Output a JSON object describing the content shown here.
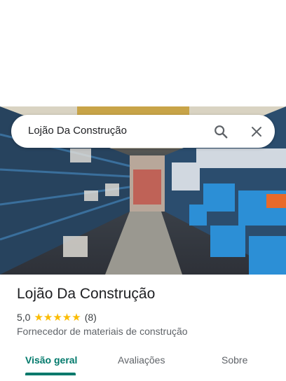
{
  "search": {
    "query": "Lojão Da Construção",
    "search_icon": "search-icon",
    "close_icon": "close-icon"
  },
  "place": {
    "name": "Lojão Da Construção",
    "rating": "5,0",
    "stars": "★★★★★",
    "review_count": "(8)",
    "category": "Fornecedor de materiais de construção"
  },
  "tabs": [
    {
      "label": "Visão geral",
      "active": true
    },
    {
      "label": "Avaliações",
      "active": false
    },
    {
      "label": "Sobre",
      "active": false
    }
  ],
  "colors": {
    "accent": "#00796b",
    "star": "#fbbc04"
  }
}
